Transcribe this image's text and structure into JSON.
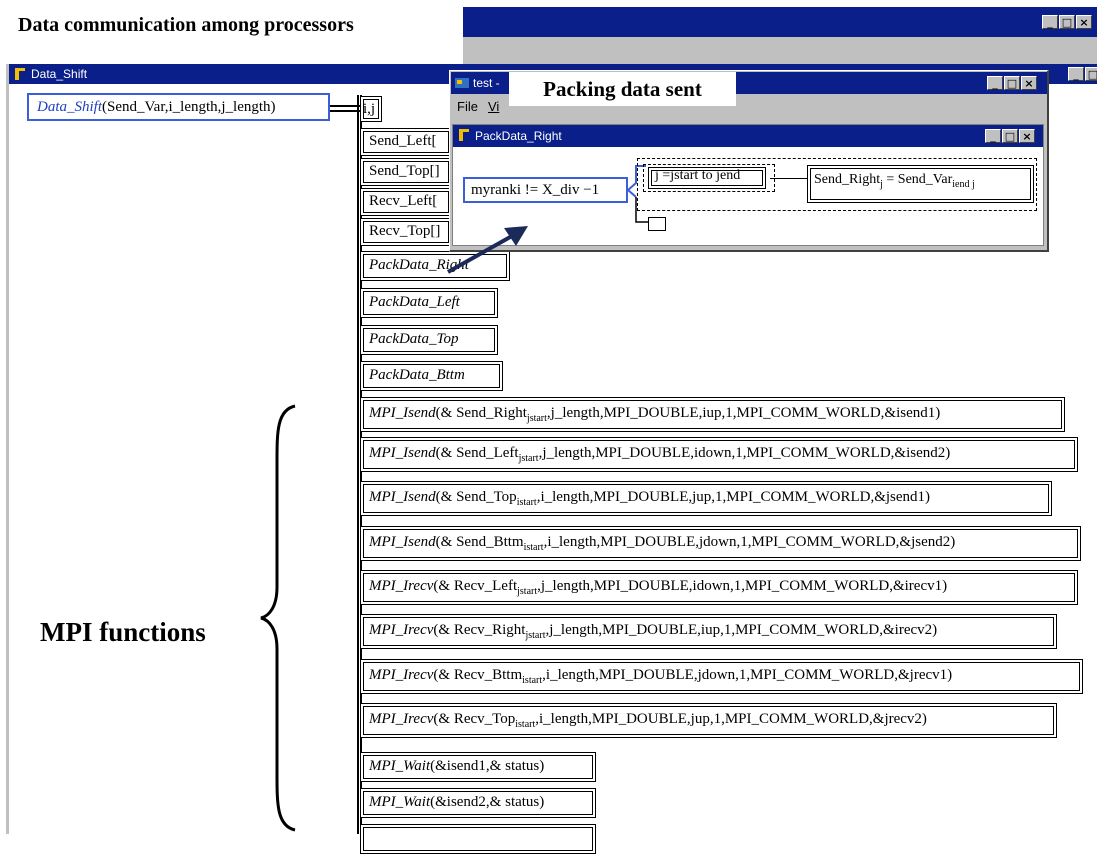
{
  "slide": {
    "title": "Data communication among processors",
    "callout_packing": "Packing data sent",
    "brace_label": "MPI functions"
  },
  "background_window": {
    "buttons": [
      "_",
      "□",
      "×"
    ]
  },
  "main_window": {
    "title": "Data_Shift",
    "root_node": {
      "function_name": "Data_Shift",
      "args": "(Send_Var,i_length,j_length)"
    },
    "loop_vars": "i,j",
    "decl_boxes": [
      "Send_Left[",
      "Send_Top[]",
      "Recv_Left[",
      "Recv_Top[]"
    ],
    "pack_boxes": [
      "PackData_Right",
      "PackData_Left",
      "PackData_Top",
      "PackData_Bttm"
    ],
    "mpi_calls": [
      {
        "fn": "MPI_Isend",
        "pre": "(& Send_Right",
        "sub": "jstart",
        "post": ",j_length,MPI_DOUBLE,iup,1,MPI_COMM_WORLD,&isend1)"
      },
      {
        "fn": "MPI_Isend",
        "pre": "(& Send_Left",
        "sub": "jstart",
        "post": ",j_length,MPI_DOUBLE,idown,1,MPI_COMM_WORLD,&isend2)"
      },
      {
        "fn": "MPI_Isend",
        "pre": "(& Send_Top",
        "sub": "istart",
        "post": ",i_length,MPI_DOUBLE,jup,1,MPI_COMM_WORLD,&jsend1)"
      },
      {
        "fn": "MPI_Isend",
        "pre": "(& Send_Bttm",
        "sub": "istart",
        "post": ",i_length,MPI_DOUBLE,jdown,1,MPI_COMM_WORLD,&jsend2)"
      },
      {
        "fn": "MPI_Irecv",
        "pre": "(& Recv_Left",
        "sub": "jstart",
        "post": ",j_length,MPI_DOUBLE,idown,1,MPI_COMM_WORLD,&irecv1)"
      },
      {
        "fn": "MPI_Irecv",
        "pre": "(& Recv_Right",
        "sub": "jstart",
        "post": ",j_length,MPI_DOUBLE,iup,1,MPI_COMM_WORLD,&irecv2)"
      },
      {
        "fn": "MPI_Irecv",
        "pre": "(& Recv_Bttm",
        "sub": "istart",
        "post": ",i_length,MPI_DOUBLE,jdown,1,MPI_COMM_WORLD,&jrecv1)"
      },
      {
        "fn": "MPI_Irecv",
        "pre": "(& Recv_Top",
        "sub": "istart",
        "post": ",i_length,MPI_DOUBLE,jup,1,MPI_COMM_WORLD,&jrecv2)"
      }
    ],
    "wait_calls": [
      {
        "fn": "MPI_Wait",
        "args": "(&isend1,& status)"
      },
      {
        "fn": "MPI_Wait",
        "args": "(&isend2,& status)"
      }
    ]
  },
  "popup_window": {
    "title": "test -",
    "menu": [
      "File",
      "Vi"
    ],
    "inner_title": "PackData_Right",
    "condition": "myranki != X_div −1",
    "loop": "j =jstart  to jend",
    "assign_lhs": "Send_Right",
    "assign_lhs_sub": "j",
    "assign_rhs": " = Send_Var",
    "assign_rhs_sub": "iend j"
  }
}
